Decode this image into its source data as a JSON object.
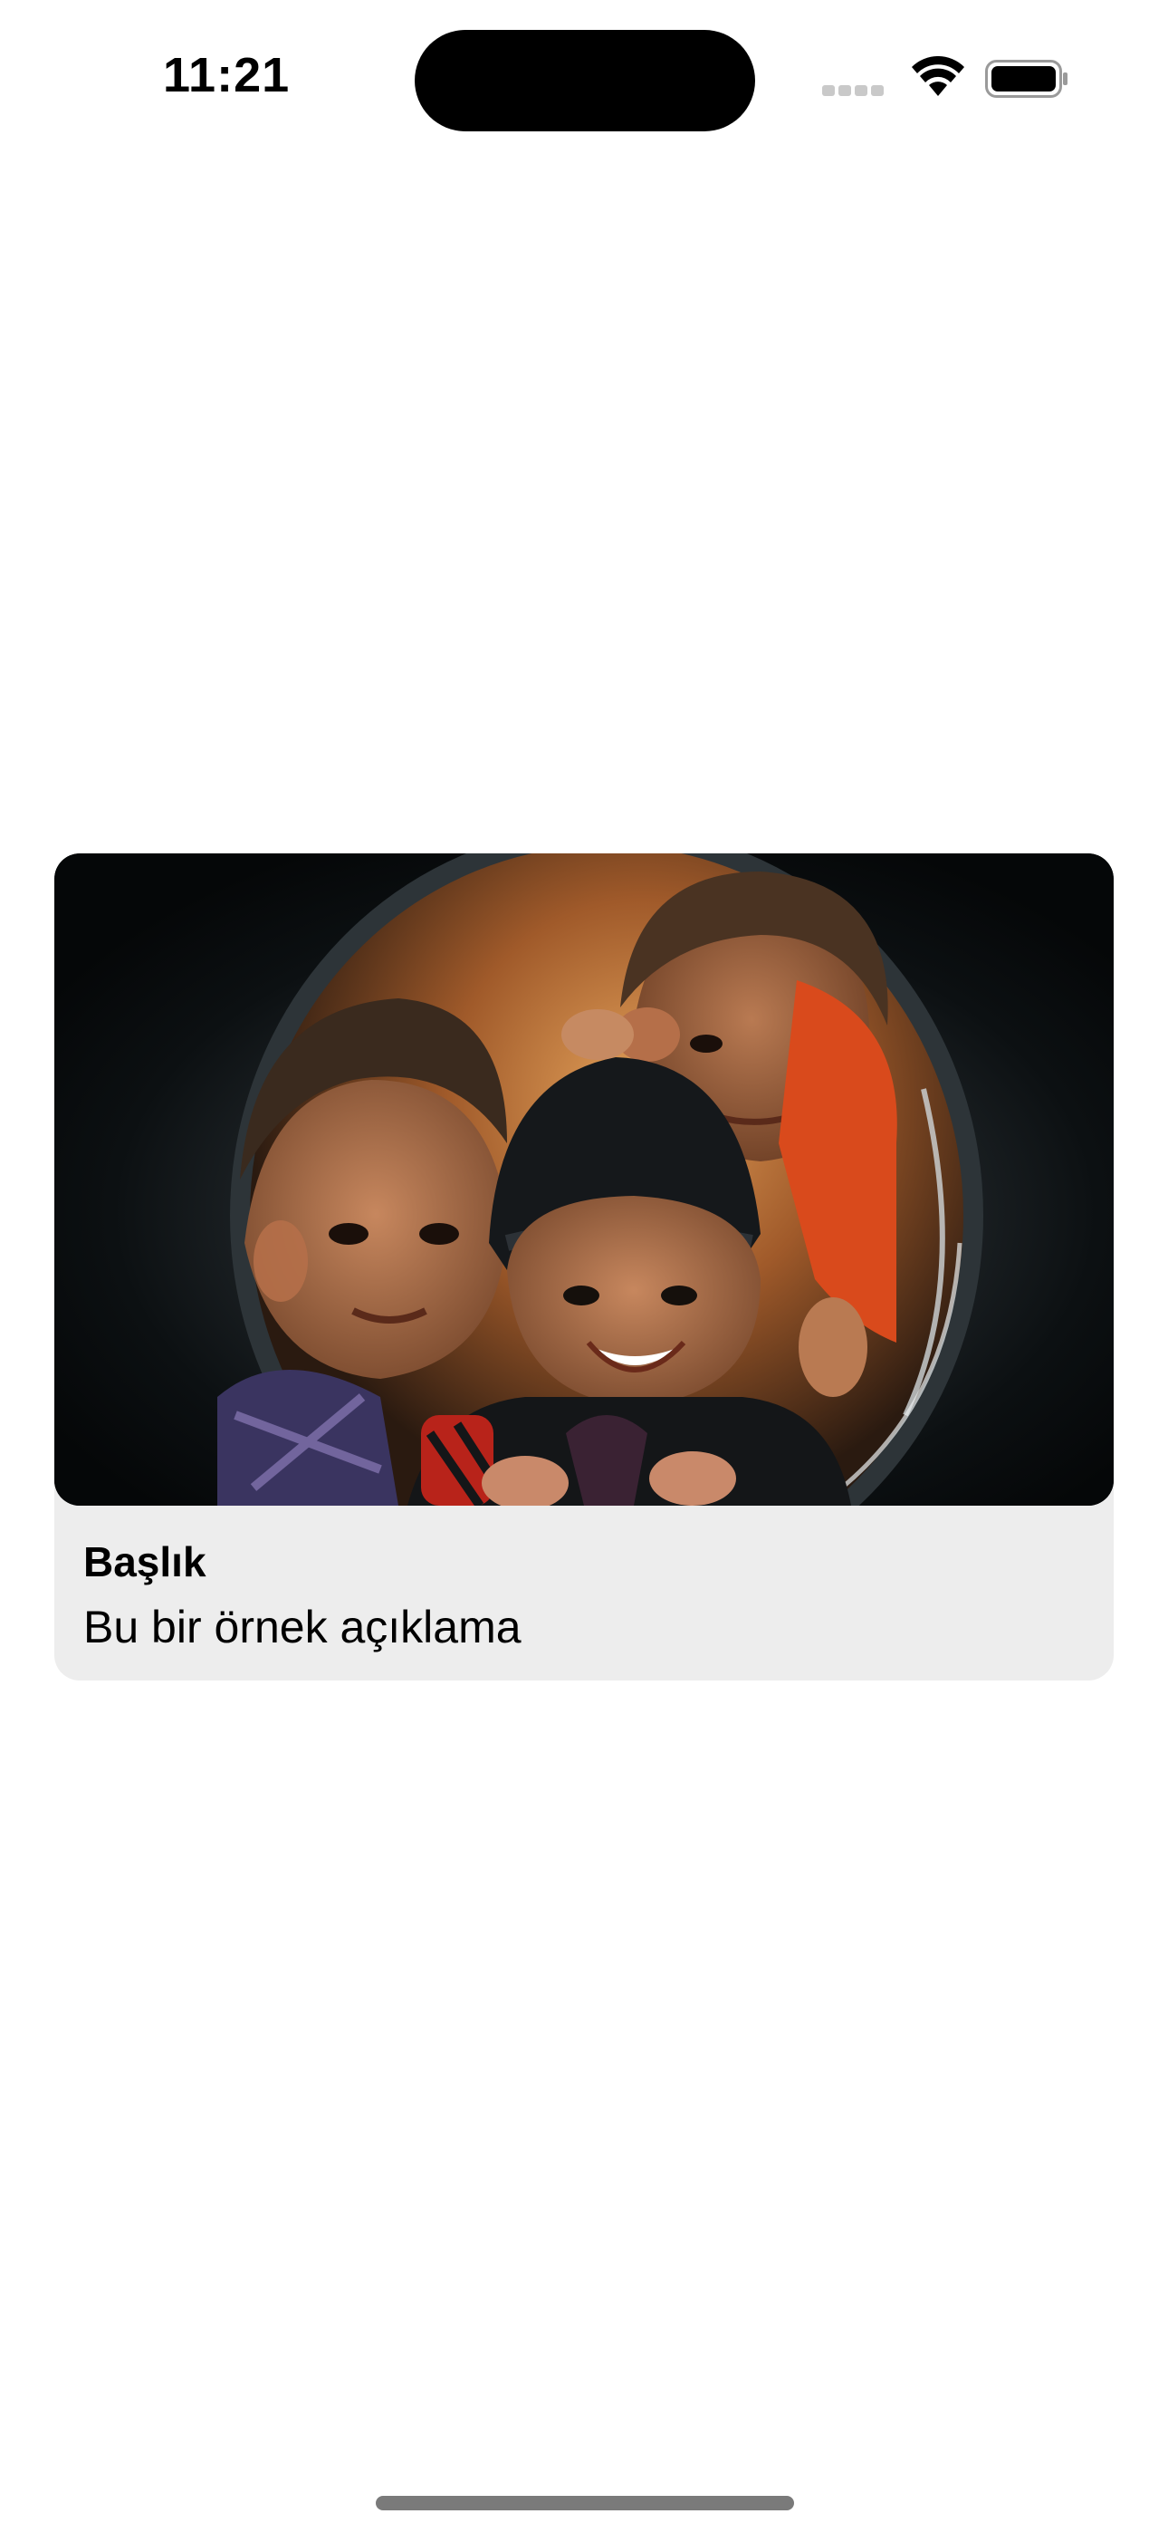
{
  "status_bar": {
    "time": "11:21",
    "icons": [
      "signal-icon",
      "wifi-icon",
      "battery-icon"
    ]
  },
  "card": {
    "image": "photo-children-in-tire",
    "title": "Başlık",
    "description": "Bu bir örnek açıklama"
  },
  "colors": {
    "background": "#ffffff",
    "card_background": "#ededed",
    "text": "#000000"
  }
}
